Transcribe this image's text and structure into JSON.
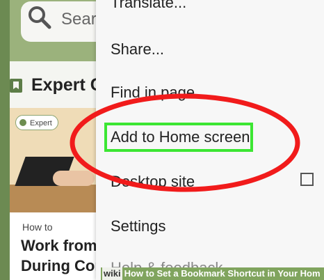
{
  "search": {
    "text": "Sear"
  },
  "section": {
    "title": "Expert C"
  },
  "card": {
    "badge": "Expert",
    "label": "How to",
    "title_line1": "Work from",
    "title_line2": "During Coro"
  },
  "menu": {
    "items": [
      {
        "label": "Translate..."
      },
      {
        "label": "Share..."
      },
      {
        "label": "Find in page"
      },
      {
        "label": "Add to Home screen"
      },
      {
        "label": "Desktop site"
      },
      {
        "label": "Settings"
      },
      {
        "label": "Help & feedback"
      }
    ],
    "desktop_site_checked": false
  },
  "footer": {
    "logo": "wiki",
    "text": "How to Set a Bookmark Shortcut in Your Hom"
  },
  "colors": {
    "highlight_box": "#3ce633",
    "circle": "#f11b1b",
    "brand_green": "#80a45e"
  },
  "icons": {
    "search": "search-icon",
    "section": "bookmark-icon",
    "badge": "check-badge-icon",
    "checkbox": "checkbox-empty-icon"
  }
}
